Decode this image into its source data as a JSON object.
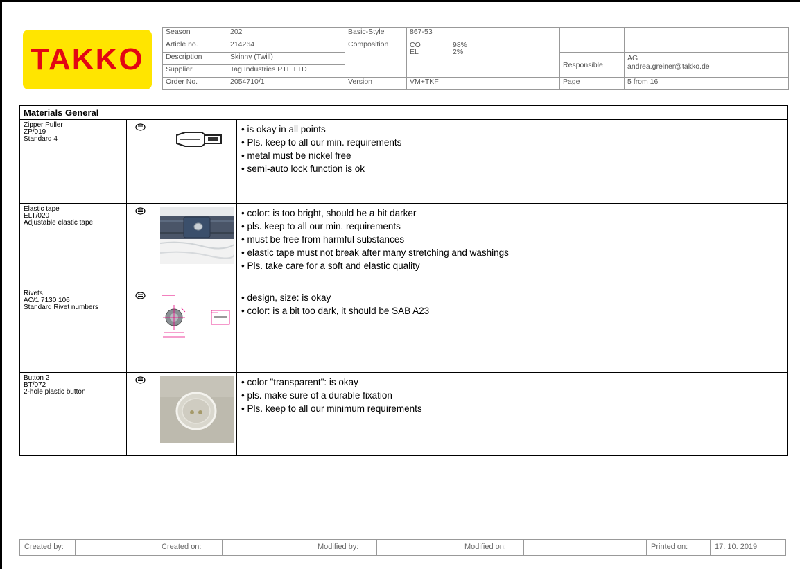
{
  "logo": {
    "text": "TAKKO"
  },
  "header": {
    "season_label": "Season",
    "season": "202",
    "article_label": "Article no.",
    "article": "214264",
    "description_label": "Description",
    "description": "Skinny (Twill)",
    "supplier_label": "Supplier",
    "supplier": "Tag Industries PTE LTD",
    "order_label": "Order No.",
    "order": "2054710/1",
    "basic_style_label": "Basic-Style",
    "basic_style": "867-53",
    "composition_label": "Composition",
    "comp1_fiber": "CO",
    "comp1_pct": "98%",
    "comp2_fiber": "EL",
    "comp2_pct": "2%",
    "version_label": "Version",
    "version": "VM+TKF",
    "responsible_label": "Responsible",
    "responsible": "AG",
    "responsible_email": "andrea.greiner@takko.de",
    "page_label": "Page",
    "page": "5 from 16"
  },
  "materials": {
    "title": "Materials General",
    "rows": [
      {
        "name": "Zipper Puller",
        "code": "ZP/019",
        "desc": "Standard 4",
        "image": "zipper-puller-image",
        "rating_icon": "smiley-icon",
        "notes": [
          "is okay in all points",
          "Pls. keep to all our min. requirements",
          "metal must be nickel free",
          "semi-auto lock function is ok"
        ]
      },
      {
        "name": "Elastic tape",
        "code": "ELT/020",
        "desc": "Adjustable elastic tape",
        "image": "elastic-tape-photo",
        "rating_icon": "smiley-icon",
        "notes": [
          "color: is too bright, should be a bit darker",
          "pls. keep to all our min. requirements",
          "must be free from harmful substances",
          "elastic tape must not break after many stretching and washings",
          "Pls. take care for a soft and elastic quality"
        ]
      },
      {
        "name": "Rivets",
        "code": "AC/1  7130 106",
        "desc": "Standard Rivet numbers",
        "image": "rivet-drawing",
        "rating_icon": "smiley-icon",
        "notes": [
          "design, size: is okay",
          "color: is a bit too dark, it should be SAB A23"
        ]
      },
      {
        "name": "Button 2",
        "code": "BT/072",
        "desc": "2-hole plastic button",
        "image": "button-photo",
        "rating_icon": "smiley-icon",
        "notes": [
          "color \"transparent\": is okay",
          "pls. make sure of a durable fixation",
          "Pls. keep to all our minimum requirements"
        ]
      }
    ]
  },
  "footer": {
    "created_by_label": "Created by:",
    "created_on_label": "Created on:",
    "modified_by_label": "Modified by:",
    "modified_on_label": "Modified on:",
    "printed_on_label": "Printed on:",
    "printed_on": "17. 10. 2019"
  }
}
